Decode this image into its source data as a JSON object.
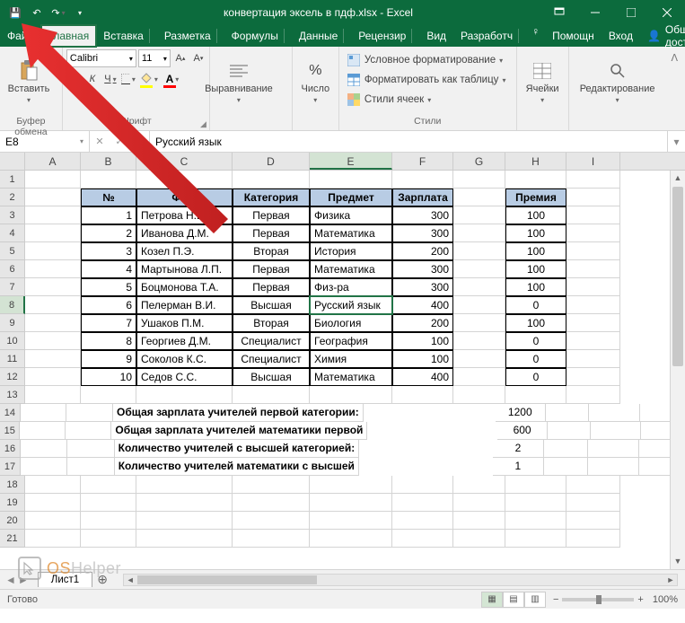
{
  "title": "конвертация эксель в пдф.xlsx - Excel",
  "tabs": [
    "Файл",
    "Главная",
    "Вставка",
    "Разметка",
    "Формулы",
    "Данные",
    "Рецензир",
    "Вид",
    "Разработч"
  ],
  "help_tabs": [
    "Помощн",
    "Вход"
  ],
  "share": "Общий доступ",
  "groups": {
    "clipboard": {
      "paste": "Вставить",
      "label": "Буфер обмена"
    },
    "font": {
      "name": "Calibri",
      "size": "11",
      "label": "Шрифт"
    },
    "align": {
      "btn": "Выравнивание",
      "label": ""
    },
    "number": {
      "btn": "Число",
      "label": ""
    },
    "styles": {
      "cond": "Условное форматирование",
      "table": "Форматировать как таблицу",
      "cell": "Стили ячеек",
      "label": "Стили"
    },
    "cells": {
      "btn": "Ячейки"
    },
    "editing": {
      "btn": "Редактирование"
    }
  },
  "namebox": "E8",
  "formula": "Русский язык",
  "cols": [
    "A",
    "B",
    "C",
    "D",
    "E",
    "F",
    "G",
    "H",
    "I"
  ],
  "headers": {
    "B": "№",
    "C": "ФИО",
    "D": "Категория",
    "E": "Предмет",
    "F": "Зарплата",
    "H": "Премия"
  },
  "rows": [
    {
      "n": 1,
      "fio": "Петрова Н.В.",
      "cat": "Первая",
      "subj": "Физика",
      "sal": "300",
      "prem": "100"
    },
    {
      "n": 2,
      "fio": "Иванова Д.М.",
      "cat": "Первая",
      "subj": "Математика",
      "sal": "300",
      "prem": "100"
    },
    {
      "n": 3,
      "fio": "Козел П.Э.",
      "cat": "Вторая",
      "subj": "История",
      "sal": "200",
      "prem": "100"
    },
    {
      "n": 4,
      "fio": "Мартынова Л.П.",
      "cat": "Первая",
      "subj": "Математика",
      "sal": "300",
      "prem": "100"
    },
    {
      "n": 5,
      "fio": "Боцмонова Т.А.",
      "cat": "Первая",
      "subj": "Физ-ра",
      "sal": "300",
      "prem": "100"
    },
    {
      "n": 6,
      "fio": "Пелерман В.И.",
      "cat": "Высшая",
      "subj": "Русский язык",
      "sal": "400",
      "prem": "0"
    },
    {
      "n": 7,
      "fio": "Ушаков П.М.",
      "cat": "Вторая",
      "subj": "Биология",
      "sal": "200",
      "prem": "100"
    },
    {
      "n": 8,
      "fio": "Георгиев Д.М.",
      "cat": "Специалист",
      "subj": "География",
      "sal": "100",
      "prem": "0"
    },
    {
      "n": 9,
      "fio": "Соколов К.С.",
      "cat": "Специалист",
      "subj": "Химия",
      "sal": "100",
      "prem": "0"
    },
    {
      "n": 10,
      "fio": "Седов С.С.",
      "cat": "Высшая",
      "subj": "Математика",
      "sal": "400",
      "prem": "0"
    }
  ],
  "summary": [
    {
      "label": "Общая зарплата учителей первой категории:",
      "val": "1200"
    },
    {
      "label": "Общая зарплата учителей математики первой",
      "val": "600"
    },
    {
      "label": "Количество учителей с высшей категорией:",
      "val": "2"
    },
    {
      "label": "Количество учителей математики с высшей",
      "val": "1"
    }
  ],
  "sheet": "Лист1",
  "status": "Готово",
  "zoom": "100%",
  "watermark": {
    "a": "OS",
    "b": "Helper"
  }
}
